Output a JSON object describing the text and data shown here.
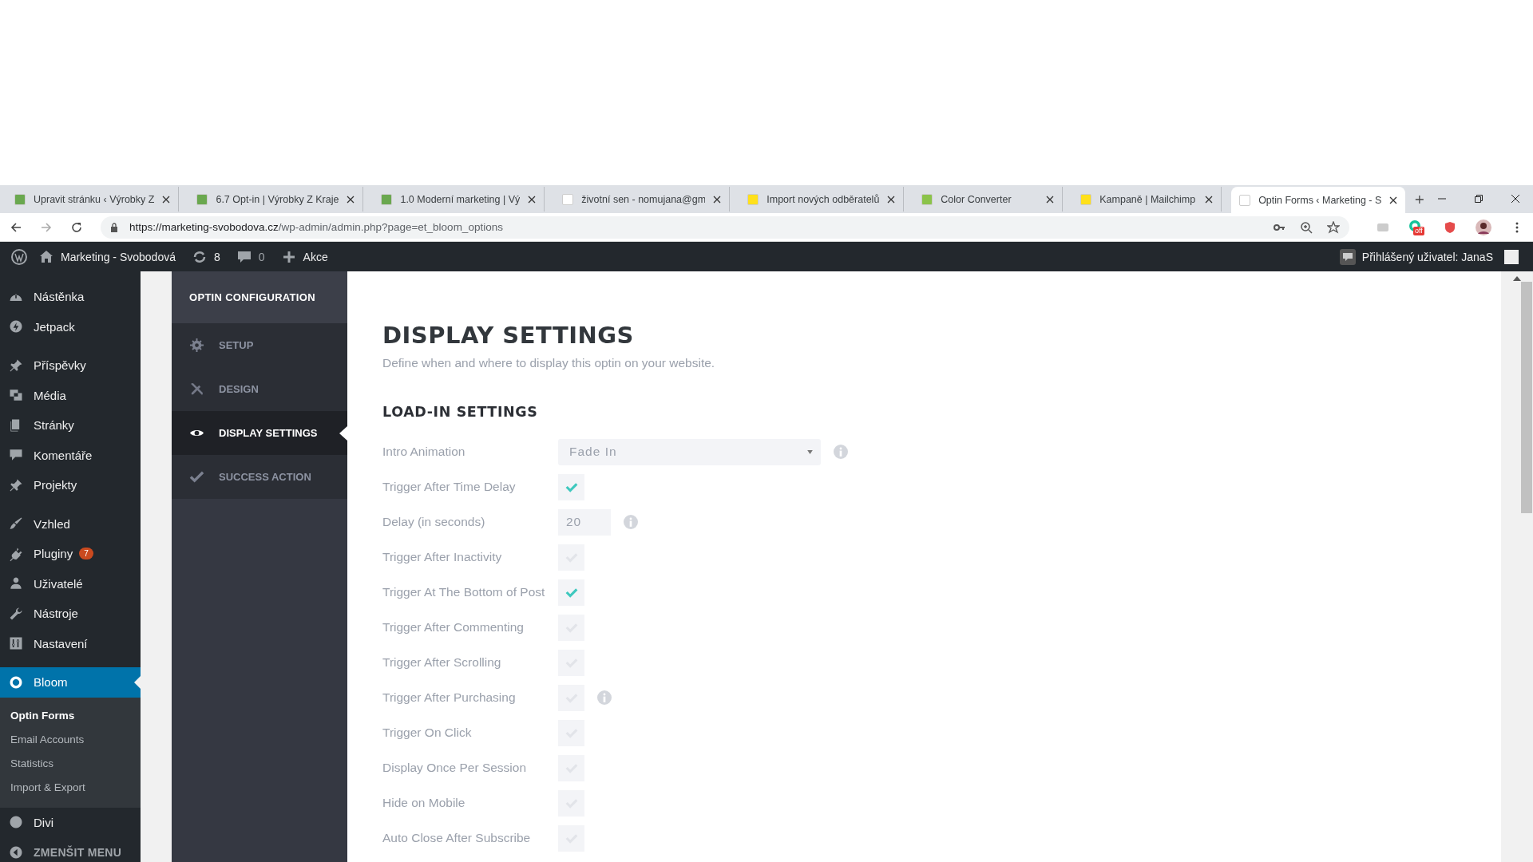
{
  "browser": {
    "tabs": [
      {
        "title": "Upravit stránku ‹ Výrobky Z",
        "selected": false
      },
      {
        "title": "6.7 Opt-in | Výrobky Z Kraje",
        "selected": false
      },
      {
        "title": "1.0 Moderní marketing | Vý",
        "selected": false
      },
      {
        "title": "životní sen - nomujana@gm",
        "selected": false
      },
      {
        "title": "Import nových odběratelů",
        "selected": false
      },
      {
        "title": "Color Converter",
        "selected": false
      },
      {
        "title": "Kampaně | Mailchimp",
        "selected": false
      },
      {
        "title": "Optin Forms ‹ Marketing - S",
        "selected": true
      }
    ],
    "url": {
      "host": "https://marketing-svobodova.cz",
      "path": "/wp-admin/admin.php?page=et_bloom_options"
    },
    "extension_badge": "off"
  },
  "admin_bar": {
    "site": "Marketing - Svobodová",
    "updates": "8",
    "comments": "0",
    "new": "Akce",
    "user": "Přihlášený uživatel: JanaS"
  },
  "sidebar": {
    "groups": [
      [
        {
          "label": "Nástěnka",
          "selected": false
        },
        {
          "label": "Jetpack",
          "selected": false
        }
      ],
      [
        {
          "label": "Příspěvky",
          "selected": false
        },
        {
          "label": "Média",
          "selected": false
        },
        {
          "label": "Stránky",
          "selected": false
        },
        {
          "label": "Komentáře",
          "selected": false
        },
        {
          "label": "Projekty",
          "selected": false
        }
      ],
      [
        {
          "label": "Vzhled",
          "selected": false
        },
        {
          "label": "Pluginy",
          "badge": "7",
          "selected": false
        },
        {
          "label": "Uživatelé",
          "selected": false
        },
        {
          "label": "Nástroje",
          "selected": false
        },
        {
          "label": "Nastavení",
          "selected": false
        }
      ],
      [
        {
          "label": "Bloom",
          "selected": true,
          "children": [
            {
              "label": "Optin Forms",
              "selected": true
            },
            {
              "label": "Email Accounts",
              "selected": false
            },
            {
              "label": "Statistics",
              "selected": false
            },
            {
              "label": "Import & Export",
              "selected": false
            }
          ]
        },
        {
          "label": "Divi",
          "selected": false
        },
        {
          "label": "ZMENŠIT MENU",
          "selected": false
        }
      ]
    ]
  },
  "bloom_nav": {
    "title": "OPTIN CONFIGURATION",
    "items": [
      {
        "label": "SETUP",
        "selected": false
      },
      {
        "label": "DESIGN",
        "selected": false
      },
      {
        "label": "DISPLAY SETTINGS",
        "selected": true
      },
      {
        "label": "SUCCESS ACTION",
        "selected": false
      }
    ]
  },
  "page": {
    "title": "DISPLAY SETTINGS",
    "subtitle": "Define when and where to display this optin on your website.",
    "section": "LOAD-IN SETTINGS",
    "settings": [
      {
        "kind": "select",
        "label": "Intro Animation",
        "value": "Fade In",
        "info": true
      },
      {
        "kind": "checkbox",
        "label": "Trigger After Time Delay",
        "checked": true,
        "info": false
      },
      {
        "kind": "number",
        "label": "Delay (in seconds)",
        "value": "20",
        "info": true
      },
      {
        "kind": "checkbox",
        "label": "Trigger After Inactivity",
        "checked": false,
        "info": false
      },
      {
        "kind": "checkbox",
        "label": "Trigger At The Bottom of Post",
        "checked": true,
        "info": false
      },
      {
        "kind": "checkbox",
        "label": "Trigger After Commenting",
        "checked": false,
        "info": false
      },
      {
        "kind": "checkbox",
        "label": "Trigger After Scrolling",
        "checked": false,
        "info": false
      },
      {
        "kind": "checkbox",
        "label": "Trigger After Purchasing",
        "checked": false,
        "info": true
      },
      {
        "kind": "checkbox",
        "label": "Trigger On Click",
        "checked": false,
        "info": false
      },
      {
        "kind": "checkbox",
        "label": "Display Once Per Session",
        "checked": false,
        "info": false
      },
      {
        "kind": "checkbox",
        "label": "Hide on Mobile",
        "checked": false,
        "info": false
      },
      {
        "kind": "checkbox",
        "label": "Auto Close After Subscribe",
        "checked": false,
        "info": false
      }
    ]
  }
}
